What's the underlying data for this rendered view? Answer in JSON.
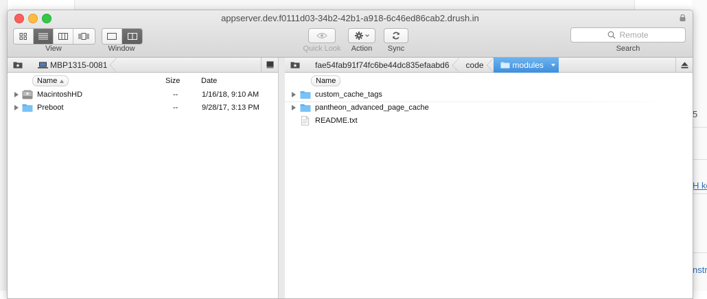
{
  "window": {
    "title": "appserver.dev.f0111d03-34b2-42b1-a918-6c46ed86cab2.drush.in"
  },
  "toolbar": {
    "view_label": "View",
    "window_label": "Window",
    "quicklook_label": "Quick Look",
    "action_label": "Action",
    "sync_label": "Sync",
    "search_label": "Search",
    "search_placeholder": "Remote",
    "view_modes": [
      "icon-view",
      "list-view",
      "column-view",
      "coverflow-view"
    ],
    "view_selected": "list-view",
    "window_modes": [
      "single-pane",
      "dual-pane"
    ],
    "window_selected": "dual-pane"
  },
  "left_pane": {
    "path": [
      "MBP1315-0081"
    ],
    "columns": {
      "name": "Name",
      "size": "Size",
      "date": "Date"
    },
    "rows": [
      {
        "name": "MacintoshHD",
        "size": "--",
        "date": "1/16/18, 9:10 AM",
        "icon": "hard-drive-icon"
      },
      {
        "name": "Preboot",
        "size": "--",
        "date": "9/28/17, 3:13 PM",
        "icon": "folder-icon"
      }
    ]
  },
  "right_pane": {
    "path": [
      "fae54fab91f74fc6be44dc835efaabd6",
      "code",
      "modules"
    ],
    "columns": {
      "name": "Name"
    },
    "rows": [
      {
        "name": "custom_cache_tags",
        "icon": "folder-icon",
        "expandable": true
      },
      {
        "name": "pantheon_advanced_page_cache",
        "icon": "folder-icon",
        "expandable": true
      },
      {
        "name": "README.txt",
        "icon": "text-file-icon",
        "expandable": false
      }
    ]
  },
  "background": {
    "fragment_1": "5",
    "fragment_2": "H ke",
    "fragment_3": "nstr"
  },
  "colors": {
    "accent": "#4a9be4",
    "folder": "#6cb8ef",
    "traffic_close": "#fc605c",
    "traffic_minimize": "#fdbc40",
    "traffic_zoom": "#34c84a"
  }
}
